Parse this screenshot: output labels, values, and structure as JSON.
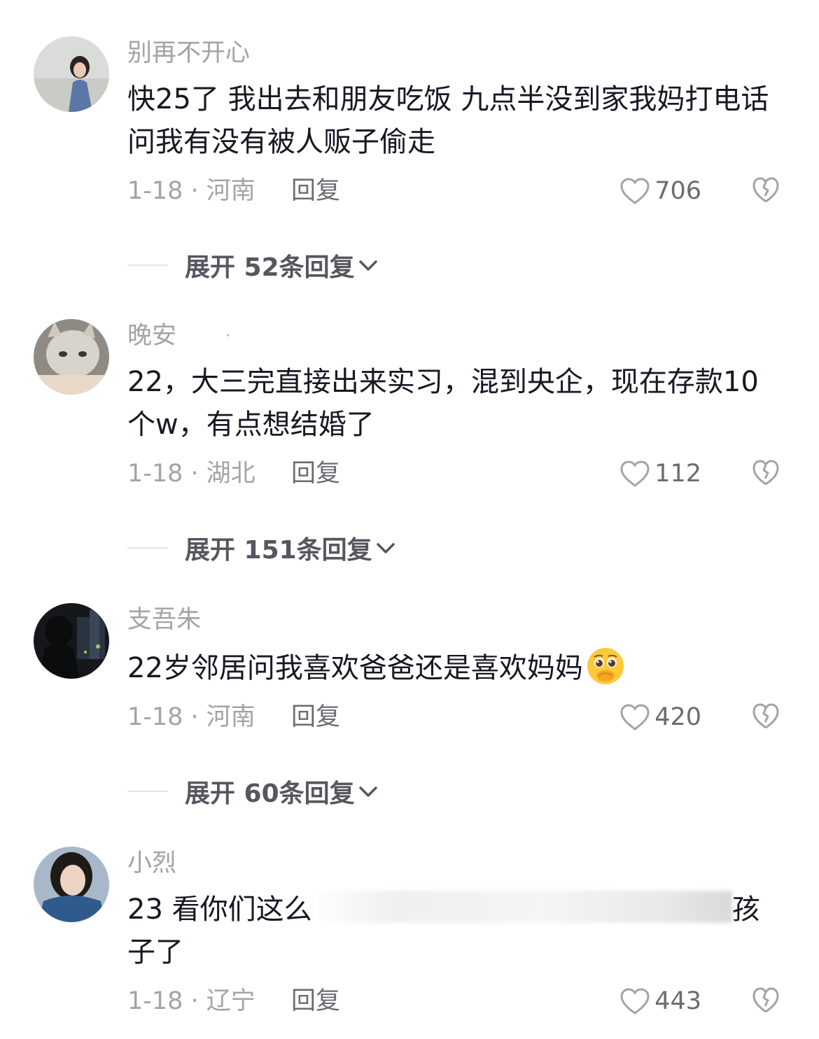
{
  "comments": [
    {
      "username": "别再不开心",
      "content": "快25了 我出去和朋友吃饭 九点半没到家我妈打电话问我有没有被人贩子偷走",
      "date": "1-18 · 河南",
      "reply_label": "回复",
      "likes": "706",
      "expand": "展开 52条回复"
    },
    {
      "username": "晚安",
      "username_suffix": "·",
      "content": "22，大三完直接出来实习，混到央企，现在存款10个w，有点想结婚了",
      "date": "1-18 · 湖北",
      "reply_label": "回复",
      "likes": "112",
      "expand": "展开 151条回复"
    },
    {
      "username": "支吾朱",
      "content": "22岁邻居问我喜欢爸爸还是喜欢妈妈",
      "emoji": "pleading-face-covering-mouth",
      "date": "1-18 · 河南",
      "reply_label": "回复",
      "likes": "420",
      "expand": "展开 60条回复"
    },
    {
      "username": "小烈",
      "content_start": "23 看你们这么",
      "content_end": "孩",
      "content_line2": "子了",
      "date": "1-18 · 辽宁",
      "reply_label": "回复",
      "likes": "443"
    }
  ]
}
